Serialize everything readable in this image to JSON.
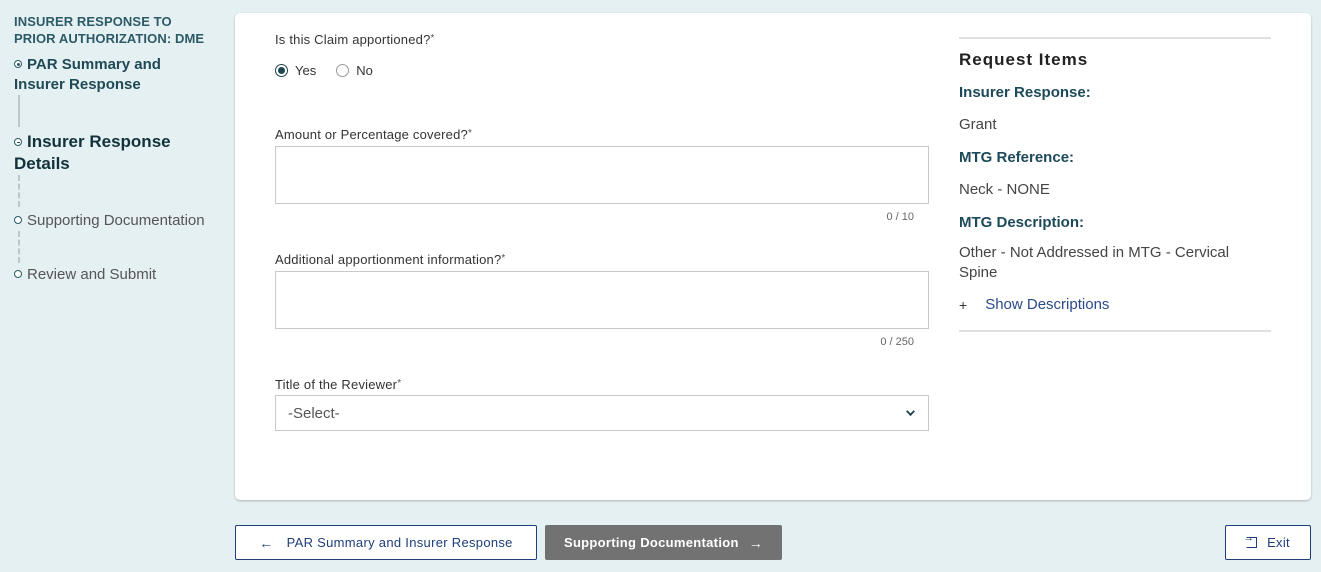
{
  "sidebar": {
    "title": "INSURER RESPONSE TO PRIOR AUTHORIZATION: DME",
    "steps": [
      {
        "label": "PAR Summary and Insurer Response",
        "state": "complete"
      },
      {
        "label": "Insurer Response Details",
        "state": "current"
      },
      {
        "label": "Supporting Documentation",
        "state": "pending"
      },
      {
        "label": "Review and Submit",
        "state": "pending"
      }
    ]
  },
  "form": {
    "apportioned": {
      "label": "Is this Claim apportioned?",
      "required_mark": "*",
      "options": [
        {
          "label": "Yes",
          "checked": true
        },
        {
          "label": "No",
          "checked": false
        }
      ]
    },
    "amount": {
      "label": "Amount or Percentage covered?",
      "required_mark": "*",
      "value": "",
      "counter": "0 / 10"
    },
    "additional_info": {
      "label": "Additional apportionment information?",
      "required_mark": "*",
      "value": "",
      "counter": "0 / 250"
    },
    "reviewer_title": {
      "label": "Title of the Reviewer",
      "required_mark": "*",
      "selected": "-Select-"
    }
  },
  "request_items": {
    "title": "Request Items",
    "insurer_response_label": "Insurer Response:",
    "insurer_response_value": "Grant",
    "mtg_reference_label": "MTG Reference:",
    "mtg_reference_value": "Neck - NONE",
    "mtg_description_label": "MTG Description:",
    "mtg_description_value": "Other - Not Addressed in MTG - Cervical Spine",
    "show_descriptions_icon": "+",
    "show_descriptions_label": "Show Descriptions"
  },
  "footer": {
    "back_icon": "←",
    "back_label": "PAR Summary and Insurer Response",
    "next_label": "Supporting Documentation",
    "next_icon": "→",
    "exit_label": "Exit"
  }
}
